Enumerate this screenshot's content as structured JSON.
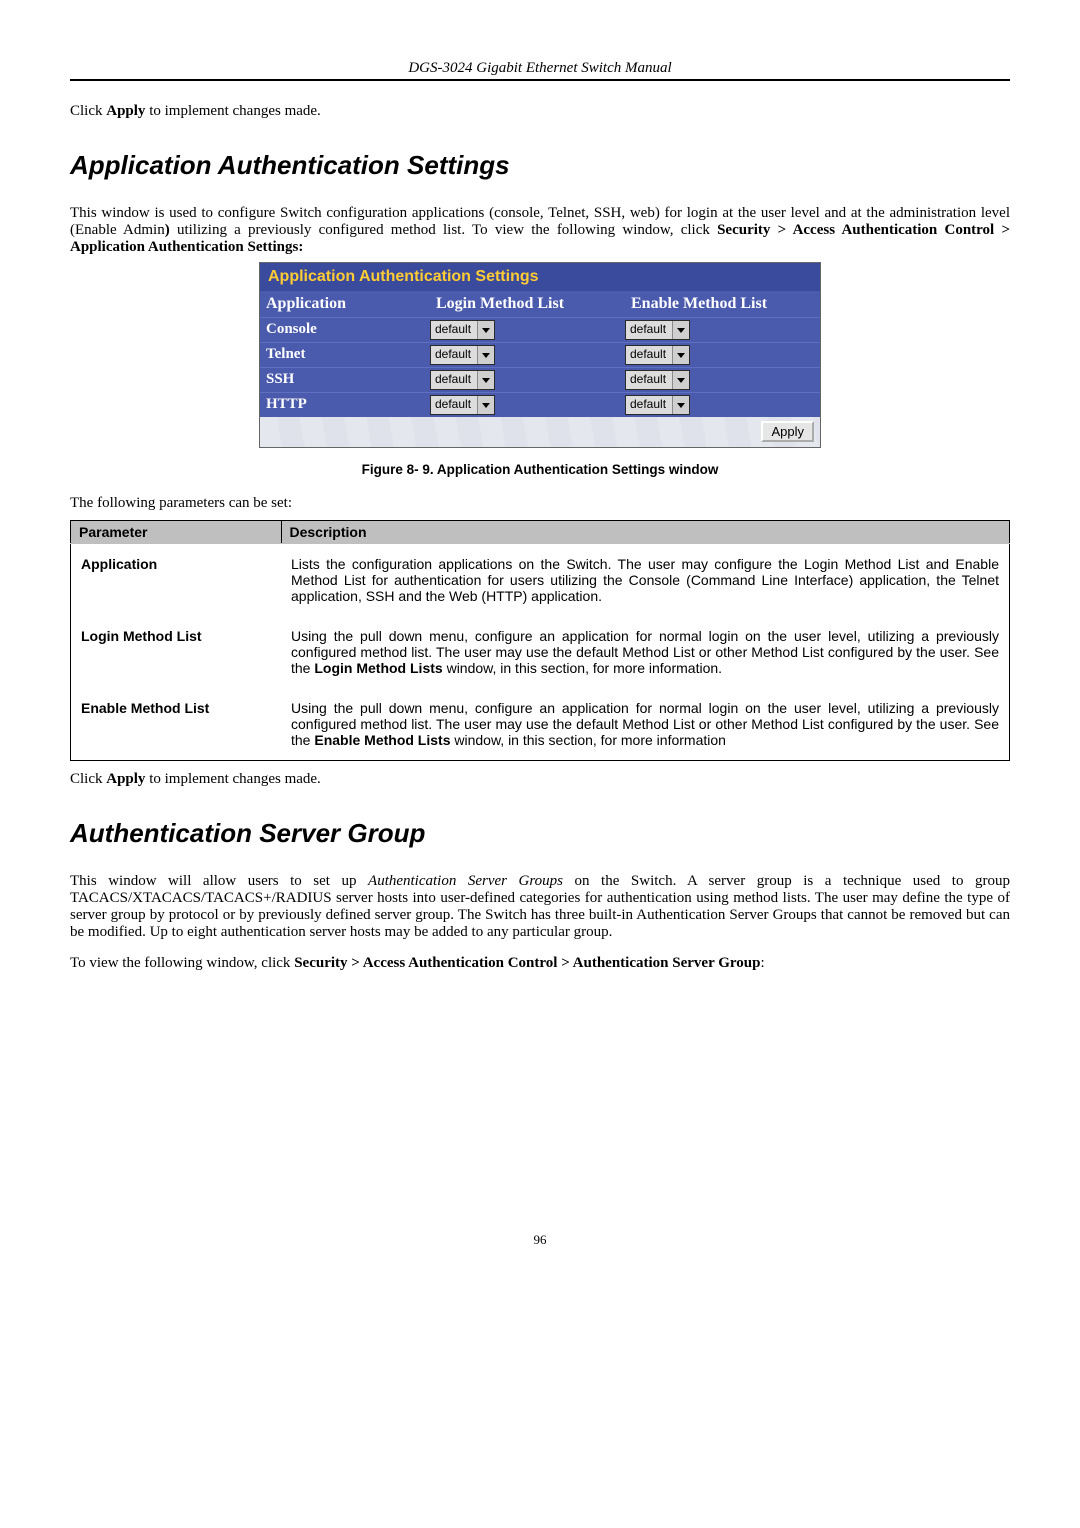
{
  "header": "DGS-3024 Gigabit Ethernet Switch Manual",
  "intro_click": {
    "pre": "Click ",
    "bold": "Apply",
    "post": " to implement changes made."
  },
  "section1": {
    "heading": "Application Authentication Settings",
    "para_pre": "This window is used to configure Switch configuration applications (console, Telnet, SSH, web) for login at the user level and at the administration level (Enable Admin",
    "para_post": " utilizing a previously configured method list. To view the following window, click ",
    "nav": "Security > Access Authentication Control > Application Authentication Settings:"
  },
  "cfg_window": {
    "title": "Application Authentication Settings",
    "col_app": "Application",
    "col_login": "Login Method List",
    "col_enable": "Enable Method List",
    "rows": [
      {
        "app": "Console",
        "login": "default",
        "enable": "default"
      },
      {
        "app": "Telnet",
        "login": "default",
        "enable": "default"
      },
      {
        "app": "SSH",
        "login": "default",
        "enable": "default"
      },
      {
        "app": "HTTP",
        "login": "default",
        "enable": "default"
      }
    ],
    "apply": "Apply"
  },
  "fig_caption": "Figure 8- 9. Application Authentication Settings window",
  "following_params": "The following parameters can be set:",
  "param_table": {
    "h_param": "Parameter",
    "h_desc": "Description",
    "rows": [
      {
        "param": "Application",
        "desc": "Lists the configuration applications on the Switch. The user may configure the Login Method List and Enable Method List for authentication for users utilizing the Console (Command Line Interface) application, the Telnet application, SSH and the Web (HTTP) application."
      },
      {
        "param": "Login Method List",
        "desc_pre": "Using the pull down menu, configure an application for normal login on the user level, utilizing a previously configured method list. The user may use the default Method List or other Method List configured by the user. See the ",
        "desc_bold": "Login Method Lists",
        "desc_post": " window, in this section, for more information."
      },
      {
        "param": "Enable Method List",
        "desc_pre": "Using the pull down menu, configure an application for normal login on the user level, utilizing a previously configured method list. The user may use the default Method List or other Method List configured by the user. See the ",
        "desc_bold": "Enable Method Lists",
        "desc_post": " window, in this section, for more information"
      }
    ]
  },
  "outro_click": {
    "pre": "Click ",
    "bold": "Apply",
    "post": " to implement changes made."
  },
  "section2": {
    "heading": "Authentication Server Group",
    "para_pre": "This window will allow users to set up ",
    "para_em": "Authentication Server Groups",
    "para_post": " on the Switch. A server group is a technique used to group TACACS/XTACACS/TACACS+/RADIUS server hosts into user-defined categories for authentication using method lists. The user may define the type of server group by protocol or by previously defined server group. The Switch has three built-in Authentication Server Groups that cannot be removed but can be modified. Up to eight authentication server hosts may be added to any particular group.",
    "nav_pre": "To view the following window, click ",
    "nav": "Security > Access Authentication Control > Authentication Server Group",
    "nav_post": ":"
  },
  "page_number": "96"
}
